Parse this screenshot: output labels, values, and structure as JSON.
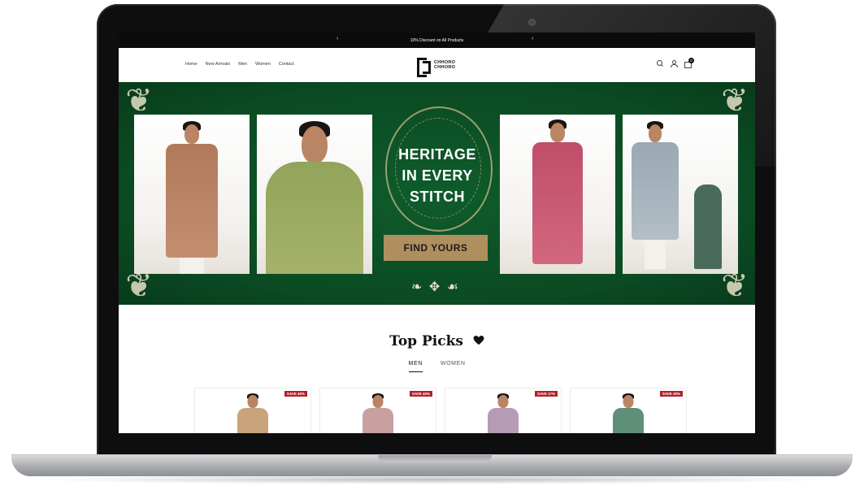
{
  "announcement": {
    "text": "10% Discount on All Products",
    "prev_arrow": "‹",
    "next_arrow": "›"
  },
  "nav": {
    "items": [
      "Home",
      "New Arrivals",
      "Men",
      "Women",
      "Contact"
    ]
  },
  "brand": {
    "logo_line1": "CHHORO",
    "logo_line2": "CHHORO"
  },
  "header": {
    "cart_count": "0"
  },
  "hero": {
    "title_line1": "HERITAGE",
    "title_line2": "IN EVERY",
    "title_line3": "STITCH",
    "cta_label": "FIND YOURS"
  },
  "top_picks": {
    "title": "Top Picks",
    "tabs": [
      "MEN",
      "WOMEN"
    ],
    "active_tab": "MEN",
    "products": [
      {
        "badge": "SAVE 40%",
        "kurta_color": "#c9a37a"
      },
      {
        "badge": "SAVE 40%",
        "kurta_color": "#c8a0a0"
      },
      {
        "badge": "SAVE 17%",
        "kurta_color": "#b79bb3"
      },
      {
        "badge": "SAVE 40%",
        "kurta_color": "#5f8f79"
      }
    ]
  },
  "colors": {
    "hero_green": "#0b4a22",
    "cta_gold": "#b08f5e",
    "badge_red": "#b2202a"
  }
}
